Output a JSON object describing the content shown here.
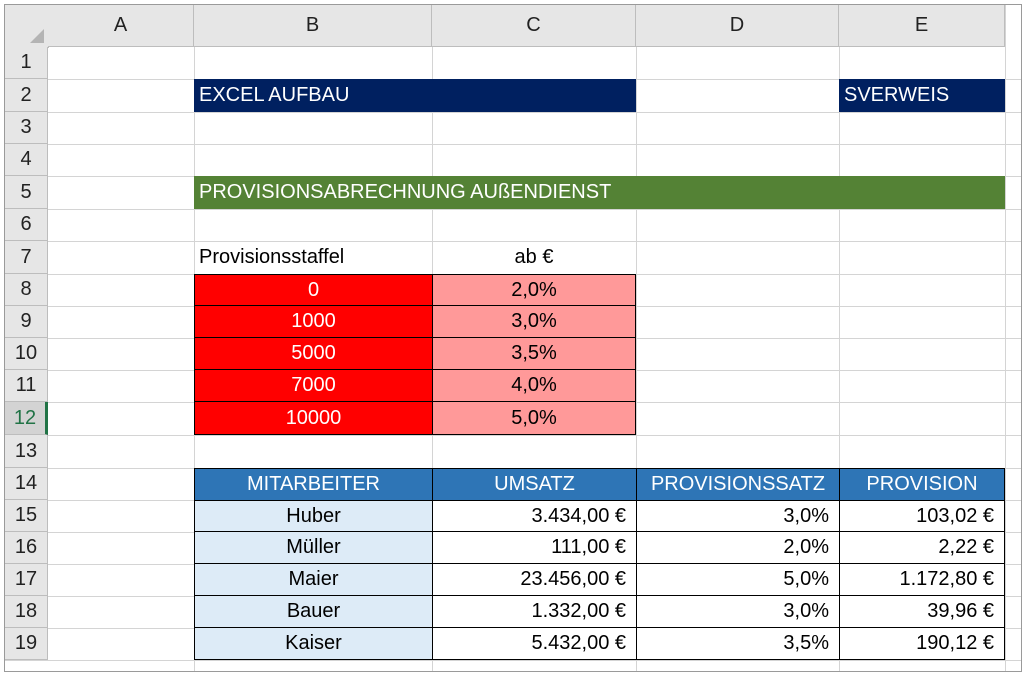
{
  "columns": [
    "A",
    "B",
    "C",
    "D",
    "E"
  ],
  "rows": [
    "1",
    "2",
    "3",
    "4",
    "5",
    "6",
    "7",
    "8",
    "9",
    "10",
    "11",
    "12",
    "13",
    "14",
    "15",
    "16",
    "17",
    "18",
    "19"
  ],
  "active_row": "12",
  "header": {
    "title": "EXCEL AUFBAU",
    "tag": "SVERWEIS",
    "section": "PROVISIONSABRECHNUNG AUßENDIENST"
  },
  "staffel": {
    "label": "Provisionsstaffel",
    "label2": "ab €",
    "items": [
      {
        "threshold": "0",
        "rate": "2,0%"
      },
      {
        "threshold": "1000",
        "rate": "3,0%"
      },
      {
        "threshold": "5000",
        "rate": "3,5%"
      },
      {
        "threshold": "7000",
        "rate": "4,0%"
      },
      {
        "threshold": "10000",
        "rate": "5,0%"
      }
    ]
  },
  "table": {
    "headers": [
      "MITARBEITER",
      "UMSATZ",
      "PROVISIONSSATZ",
      "PROVISION"
    ],
    "rows": [
      {
        "name": "Huber",
        "umsatz": "3.434,00 €",
        "satz": "3,0%",
        "provision": "103,02 €"
      },
      {
        "name": "Müller",
        "umsatz": "111,00 €",
        "satz": "2,0%",
        "provision": "2,22 €"
      },
      {
        "name": "Maier",
        "umsatz": "23.456,00 €",
        "satz": "5,0%",
        "provision": "1.172,80 €"
      },
      {
        "name": "Bauer",
        "umsatz": "1.332,00 €",
        "satz": "3,0%",
        "provision": "39,96 €"
      },
      {
        "name": "Kaiser",
        "umsatz": "5.432,00 €",
        "satz": "3,5%",
        "provision": "190,12 €"
      }
    ]
  },
  "colors": {
    "banner_blue": "#002060",
    "banner_green": "#548235",
    "staffel_red": "#ff0000",
    "staffel_pink": "#ff9999",
    "table_header": "#2e75b6",
    "table_name_fill": "#ddebf7"
  }
}
